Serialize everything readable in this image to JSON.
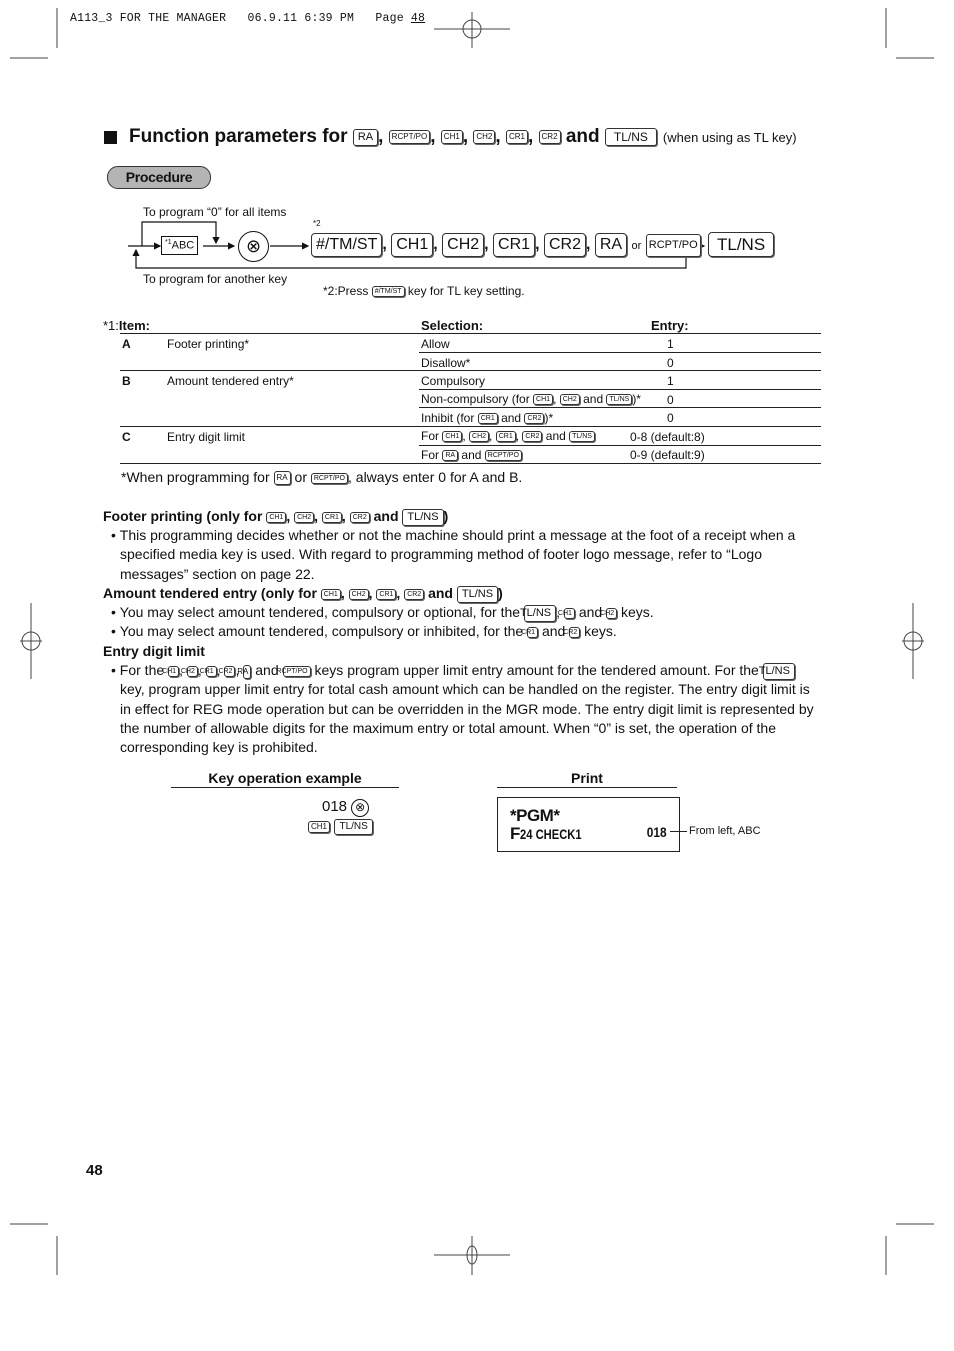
{
  "print_header": {
    "job": "A113_3 FOR THE MANAGER",
    "date": "06.9.11",
    "time": "6:39 PM",
    "page_label": "Page",
    "page_num": "48"
  },
  "title": {
    "prefix": "Function parameters for",
    "keys": [
      "RA",
      "RCPT/PO",
      "CH1",
      "CH2",
      "CR1",
      "CR2"
    ],
    "and": "and",
    "last_key": "TL/NS",
    "note": "(when using as TL key)"
  },
  "procedure_label": "Procedure",
  "diagram": {
    "loop_top_label": "To program  “0” for all items",
    "loop_bottom_label": "To program for another key",
    "abc_box": "ABC",
    "abc_sup": "*1",
    "multiply_symbol": "⊗",
    "star2": "*2",
    "keys": [
      "#/TM/ST",
      "CH1",
      "CH2",
      "CR1",
      "CR2",
      "RA"
    ],
    "or_label": "or",
    "rcpt_key": "RCPT/PO",
    "final_key": "TL/NS",
    "note_prefix": "*2:Press",
    "note_key": "#/TM/ST",
    "note_suffix": "key for TL key setting."
  },
  "table": {
    "item_prefix": "*1:",
    "headers": {
      "item": "Item:",
      "selection": "Selection:",
      "entry": "Entry:"
    },
    "rows": [
      {
        "code": "A",
        "item": "Footer printing*",
        "selection": "Allow",
        "entry": "1"
      },
      {
        "code": "",
        "item": "",
        "selection": "Disallow*",
        "entry": "0"
      },
      {
        "code": "B",
        "item": "Amount tendered entry*",
        "selection": "Compulsory",
        "entry": "1"
      },
      {
        "code": "",
        "item": "",
        "selection_pre": "Non-compulsory (for",
        "selection_keys": [
          "CH1",
          "CH2",
          "TL/NS"
        ],
        "selection_post": ")*",
        "entry": "0"
      },
      {
        "code": "",
        "item": "",
        "selection_pre": "Inhibit (for",
        "selection_keys": [
          "CR1",
          "CR2"
        ],
        "selection_post": ")*",
        "entry": "0"
      },
      {
        "code": "C",
        "item": "Entry digit limit",
        "selection_pre": "For",
        "selection_keys": [
          "CH1",
          "CH2",
          "CR1",
          "CR2",
          "TL/NS"
        ],
        "entry": "0-8 (default:8)"
      },
      {
        "code": "",
        "item": "",
        "selection_pre": "For",
        "selection_keys": [
          "RA",
          "RCPT/PO"
        ],
        "entry": "0-9 (default:9)"
      }
    ],
    "and": "and",
    "footnote_pre": "*When programming for",
    "footnote_key1": "RA",
    "footnote_or": "or",
    "footnote_key2": "RCPT/PO",
    "footnote_post": ", always enter 0 for A and B."
  },
  "sections": {
    "footer": {
      "heading": "Footer printing (only for",
      "keys": [
        "CH1",
        "CH2",
        "CR1",
        "CR2"
      ],
      "and": "and",
      "last_key": "TL/NS",
      "bullet": "This programming decides whether or not the machine should print a message at the foot of a receipt when a specified media key is used.  With regard to programming method of footer logo message, refer to “Logo messages” section on page 22."
    },
    "amount": {
      "heading": "Amount tendered entry (only for",
      "keys": [
        "CH1",
        "CH2",
        "CR1",
        "CR2"
      ],
      "and": "and",
      "last_key": "TL/NS",
      "bullet1_pre": "You may select amount tendered, compulsory or optional, for the",
      "bullet1_keys": [
        "TL/NS",
        "CH1",
        "CH2"
      ],
      "bullet1_post": "keys.",
      "bullet2_pre": "You may select amount tendered, compulsory or inhibited, for the",
      "bullet2_keys": [
        "CR1",
        "CR2"
      ],
      "bullet2_post": "keys."
    },
    "digit": {
      "heading": "Entry digit limit",
      "pre": "For the",
      "keys": [
        "CH1",
        "CH2",
        "CR1",
        "CR2",
        "RA",
        "RCPT/PO"
      ],
      "mid1": "keys program upper limit entry amount for the tendered amount.  For the",
      "tl_key": "TL/NS",
      "rest": "key, program upper limit entry for total cash amount which can be handled on the register.  The entry digit limit is in effect for REG mode operation but can be overridden in the MGR mode.  The entry digit limit is represented by the number of allowable digits for the maximum entry or total amount.  When “0” is set, the operation of the corresponding key is prohibited."
    }
  },
  "example": {
    "key_op_title": "Key operation example",
    "print_title": "Print",
    "entry": "018",
    "symbol": "⊗",
    "keys": [
      "CH1",
      "TL/NS"
    ],
    "receipt_line1": "*PGM*",
    "receipt_f": "F",
    "receipt_line2": "24 CHECK1",
    "receipt_value": "018",
    "callout": "From left, ABC"
  },
  "page_number": "48"
}
